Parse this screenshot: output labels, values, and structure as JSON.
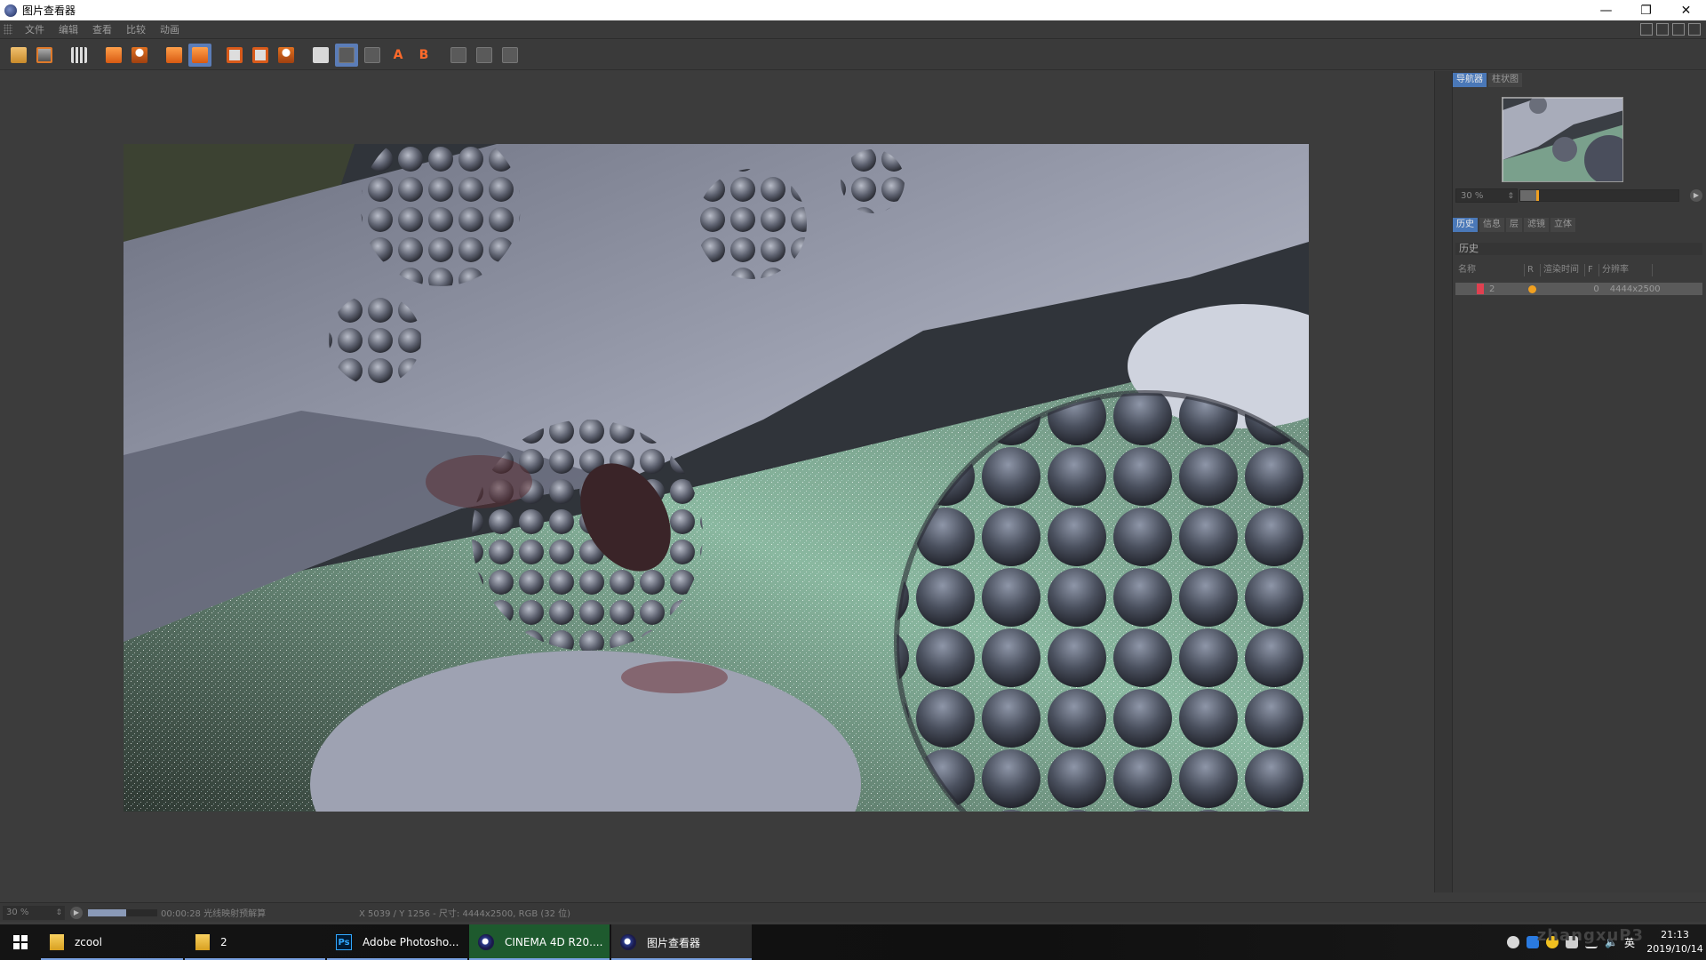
{
  "window": {
    "title": "图片查看器",
    "minimize": "—",
    "restore": "❐",
    "close": "✕"
  },
  "menu": [
    "文件",
    "编辑",
    "查看",
    "比较",
    "动画"
  ],
  "navigator": {
    "tabs": [
      {
        "label": "导航器",
        "active": true
      },
      {
        "label": "柱状图",
        "active": false
      }
    ],
    "zoom": "30 %",
    "zoom_slider_fraction": 0.1
  },
  "history_panel": {
    "tabs": [
      {
        "label": "历史",
        "active": true
      },
      {
        "label": "信息",
        "active": false
      },
      {
        "label": "层",
        "active": false
      },
      {
        "label": "滤镜",
        "active": false
      },
      {
        "label": "立体",
        "active": false
      }
    ],
    "title": "历史",
    "columns": [
      "名称",
      "R",
      "渲染时间",
      "F",
      "分辨率"
    ],
    "rows": [
      {
        "name": "2",
        "render_time": "",
        "frame": "0",
        "resolution": "4444x2500"
      }
    ]
  },
  "status": {
    "zoom": "30 %",
    "progress_fraction": 0.55,
    "time_text": "00:00:28 光线映射预解算",
    "coords_text": "X 5039 / Y 1256 - 尺寸: 4444x2500, RGB (32 位)"
  },
  "taskbar": {
    "items": [
      {
        "label": "zcool",
        "icon": "folder-icon",
        "active": false
      },
      {
        "label": "2",
        "icon": "folder-icon",
        "active": false
      },
      {
        "label": "Adobe Photosho...",
        "icon": "photoshop-icon",
        "active": false
      },
      {
        "label": "CINEMA 4D R20....",
        "icon": "cinema4d-icon",
        "active": true
      },
      {
        "label": "图片查看器",
        "icon": "cinema4d-icon",
        "active": false
      }
    ],
    "watermark": "zhangxuP3",
    "ime": "英",
    "clock_time": "21:13",
    "clock_date": "2019/10/14"
  },
  "colors": {
    "accent_tab": "#4a78b8",
    "highlight_orange": "#f0a020",
    "toolbar_orange": "#e06a1a"
  }
}
